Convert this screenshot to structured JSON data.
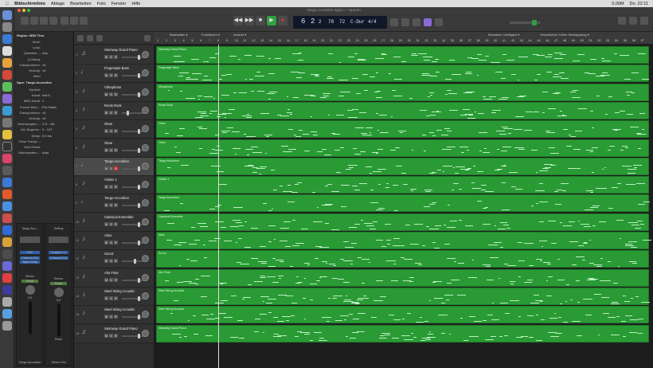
{
  "menubar": {
    "apple": "",
    "app": "Bildschirmfoto",
    "items": [
      "Ablage",
      "Bearbeiten",
      "Foto",
      "Fenster",
      "Hilfe"
    ],
    "battery": "0,00M",
    "clock": "Do. 22:11"
  },
  "window": {
    "title": "Tango Accordion.logicx — Spuren"
  },
  "lcd": {
    "bar": "6",
    "beat": "2",
    "sub": "2",
    "tempo": "78",
    "tempo2": "72",
    "key": "C-Dur",
    "sig": "4/4"
  },
  "arrange": {
    "bars": [
      "1",
      "2",
      "3",
      "4",
      "5",
      "6",
      "7",
      "8",
      "9",
      "10",
      "11",
      "12",
      "13",
      "14",
      "15",
      "16",
      "17",
      "18",
      "19",
      "20",
      "21",
      "22",
      "23",
      "24",
      "25",
      "26",
      "27",
      "28",
      "29",
      "30",
      "31",
      "32",
      "33",
      "34",
      "35",
      "36",
      "37",
      "38",
      "39",
      "40",
      "41",
      "42",
      "43",
      "44",
      "45",
      "46",
      "47",
      "48",
      "49",
      "50",
      "51",
      "52",
      "53",
      "54",
      "55",
      "56",
      "57"
    ],
    "toolbar": {
      "edit": "Bearbeiten",
      "func": "Funktionen",
      "view": "Ansicht",
      "snap_label": "Einrasten:",
      "snap": "Intelligent",
      "drag_label": "Verschieben:",
      "drag": "Keine Überlappung"
    }
  },
  "inspector": {
    "region_header": "Region: MIDI Thru",
    "region": [
      [
        "Mute:",
        ""
      ],
      [
        "Loop:",
        ""
      ],
      [
        "Quantisie...:",
        "Aus"
      ],
      [
        "Q-Swing:",
        ""
      ],
      [
        "Transponieren:",
        "±0"
      ],
      [
        "Velocity:",
        "±0"
      ],
      [
        "Mehr",
        ""
      ]
    ],
    "track_header": "Spur: Tango Accordion",
    "track": [
      [
        "Symbol:",
        ""
      ],
      [
        "Kanal:",
        "Inst 6"
      ],
      [
        "MIDI-Kanal:",
        "1"
      ],
      [
        "Freeze-Mod...:",
        "Pre-Fader"
      ],
      [
        "Transponieren:",
        "±0"
      ],
      [
        "Velocity:",
        "±0"
      ],
      [
        "Notenumgren...:",
        "C-2 - G8"
      ],
      [
        "Vel.-Begrenz.:",
        "0 - 127"
      ],
      [
        "Delay:",
        "0,0 ms"
      ],
      [
        "Ohne Transp...:",
        ""
      ],
      [
        "Kein Reset:",
        ""
      ],
      [
        "Notensystem...:",
        "Auto"
      ]
    ],
    "strip1": {
      "name": "Tango Acc...",
      "eq": "Channel EQ",
      "input": "ES2",
      "setting": "Tape Delay",
      "mode": "Stereo",
      "read": "Read",
      "vol": "0,0",
      "pan": "0",
      "bottom": "Tango Accordion"
    },
    "strip2": {
      "name": "Setting",
      "eq": "Channel EQ",
      "input": "Output 1-2",
      "mode": "Stereo",
      "read": "Read",
      "vol": "0,0",
      "pan": "0",
      "bottom": "Stereo Out",
      "bounce": "Bnce"
    }
  },
  "tracks": [
    {
      "num": "1",
      "name": "Steinway Grand Piano",
      "region": "Steinway Grand Piano",
      "fader": 0.72
    },
    {
      "num": "2",
      "name": "Fingerstyle Bass",
      "region": "Fingerstyle Bass",
      "fader": 0.72
    },
    {
      "num": "3",
      "name": "Vibraphone",
      "region": "Vibraphone",
      "fader": 0.72
    },
    {
      "num": "4",
      "name": "Roots Rock",
      "region": "Roots Rock",
      "fader": 0.2
    },
    {
      "num": "5",
      "name": "Oboe",
      "region": "Oboe",
      "fader": 0.72
    },
    {
      "num": "6",
      "name": "Oboe",
      "region": "Oboe",
      "fader": 0.72
    },
    {
      "num": "7",
      "name": "Tango Accordion",
      "region": "Tango Accordion",
      "fader": 0.72,
      "sel": true
    },
    {
      "num": "8",
      "name": "Violine 1",
      "region": "Violine 1",
      "fader": 0.72
    },
    {
      "num": "9",
      "name": "Tango Accordion",
      "region": "Tango Accordion",
      "fader": 0.72
    },
    {
      "num": "10",
      "name": "Classical Ensemble",
      "region": "Classical Ensemble",
      "fader": 0.72
    },
    {
      "num": "11",
      "name": "Altus",
      "region": "Altus",
      "fader": 0.72
    },
    {
      "num": "12",
      "name": "SoCal",
      "region": "SoCal",
      "fader": 0.55
    },
    {
      "num": "13",
      "name": "Alto Flute",
      "region": "Alto Flute",
      "fader": 0.72
    },
    {
      "num": "14",
      "name": "Steel String Acoustic",
      "region": "Steel String Acoustic",
      "fader": 0.72
    },
    {
      "num": "15",
      "name": "Steel String Acoustic",
      "region": "Steel String Acoustic",
      "fader": 0.72
    },
    {
      "num": "16",
      "name": "Steinway Grand Piano",
      "region": "Steinway Grand Piano",
      "fader": 0.72
    }
  ],
  "colors": {
    "region": "#2a9a35",
    "note": "#b8f0c0",
    "record": "#cc3333"
  }
}
